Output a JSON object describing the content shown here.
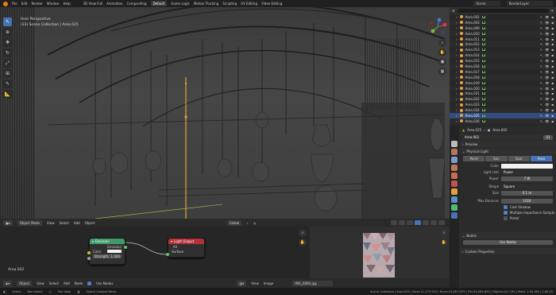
{
  "topbar": {
    "menus": [
      "File",
      "Edit",
      "Render",
      "Window",
      "Help"
    ],
    "workspaces": [
      "3D View Full",
      "Animation",
      "Compositing",
      "Default",
      "Game Logic",
      "Motion Tracking",
      "Scripting",
      "UV Editing",
      "Video Editing"
    ],
    "active_workspace": "Default",
    "scene_label": "Scene",
    "layer_label": "RenderLayer"
  },
  "viewport": {
    "view_name": "User Perspective",
    "collection_path": "(33) Scene Collection | Area.025",
    "mode": "Object Mode",
    "menus": [
      "View",
      "Select",
      "Add",
      "Object"
    ],
    "transform_orientation": "Global"
  },
  "node_editor": {
    "emission": {
      "title": "Emission",
      "output": "Emission",
      "color_label": "Color",
      "strength_label": "Strength",
      "strength_value": "1.000"
    },
    "light_output": {
      "title": "Light Output",
      "target": "All",
      "input": "Surface"
    },
    "object_name": "Area.002",
    "mode": "Object",
    "menus": [
      "View",
      "Select",
      "Add",
      "Node"
    ],
    "use_nodes_label": "Use Nodes"
  },
  "image_editor": {
    "menus": [
      "View",
      "Image"
    ],
    "image_name": "IMG_6094.jpg"
  },
  "outliner": {
    "items": [
      "Area.002",
      "Area.003",
      "Area.009",
      "Area.010",
      "Area.011",
      "Area.012",
      "Area.013",
      "Area.014",
      "Area.015",
      "Area.016",
      "Area.017",
      "Area.018",
      "Area.019",
      "Area.020",
      "Area.021",
      "Area.022",
      "Area.023",
      "Area.024",
      "Area.025",
      "Area.026"
    ],
    "selected_index": 18
  },
  "properties": {
    "breadcrumb_object": "Area.025",
    "breadcrumb_data": "Area.002",
    "datablock_name": "Area.002",
    "user_count": "41",
    "preview_label": "Preview",
    "physical_light_label": "Physical Light",
    "light_types": [
      "Point",
      "Sun",
      "Spot",
      "Area"
    ],
    "active_light_type": "Area",
    "color_label": "Color",
    "light_unit_label": "Light Unit",
    "light_unit_value": "Power",
    "power_label": "Power",
    "power_value": "7 W",
    "shape_label": "Shape",
    "shape_value": "Square",
    "size_label": "Size",
    "size_value": "0.1 m",
    "max_bounces_label": "Max Bounces",
    "max_bounces_value": "1024",
    "cast_shadow_label": "Cast Shadow",
    "mis_label": "Multiple Importance Sample",
    "portal_label": "Portal",
    "nodes_label": "Nodes",
    "use_nodes_label": "Use Nodes",
    "custom_props_label": "Custom Properties"
  },
  "statusbar": {
    "select": "Select",
    "box_select": "Box Select",
    "pan_view": "Pan View",
    "context_menu": "Object Context Menu",
    "stats": "Scene Collection | Area.025 | Verts:11,179,925 | Faces:23,857,879 | Tris:24,084,853 | Objects:0/1,190 | Mem: 1.64 GiB | 2.80.10"
  },
  "colors": {
    "accent": "#4772b3",
    "emission_header": "#3f9a6a",
    "output_header": "#b23238",
    "selection": "#e8a534"
  }
}
